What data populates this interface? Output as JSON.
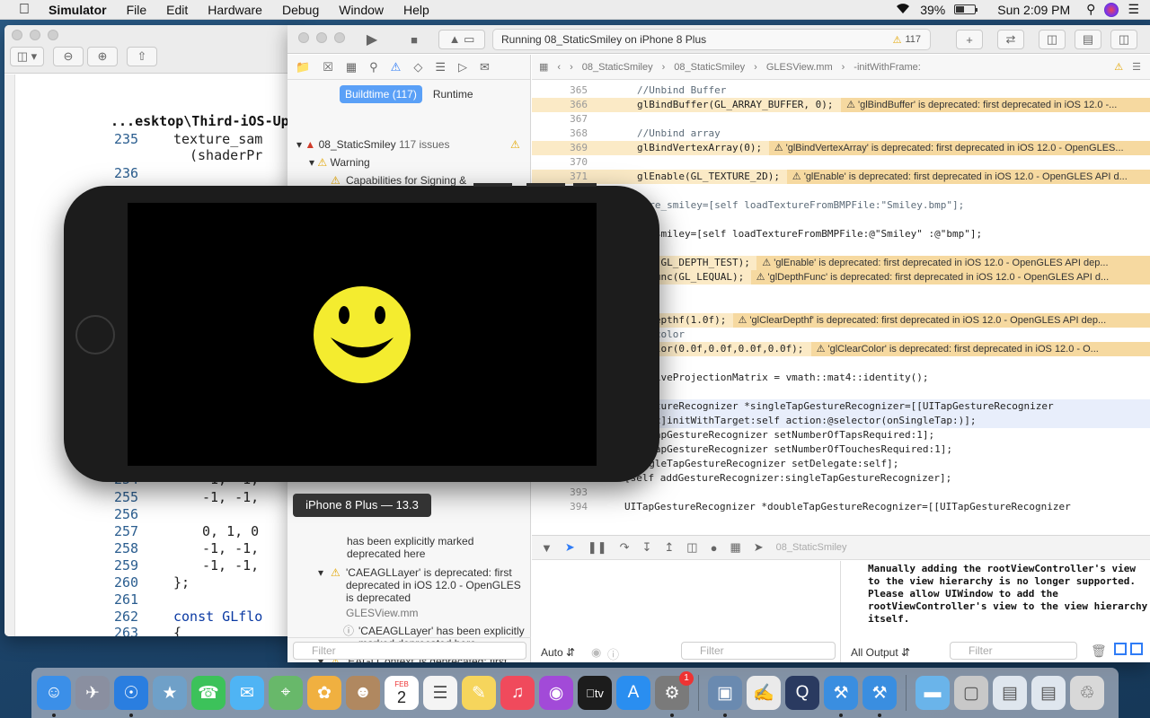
{
  "menubar": {
    "app": "Simulator",
    "items": [
      "File",
      "Edit",
      "Hardware",
      "Debug",
      "Window",
      "Help"
    ],
    "battery": "39%",
    "clock": "Sun 2:09 PM"
  },
  "left_window": {
    "path": "...esktop\\Third-iOS-Uplo",
    "lines": [
      {
        "n": "235",
        "text": "texture_sam"
      },
      {
        "n": "",
        "text": "(shaderPr"
      },
      {
        "n": "236",
        "text": ""
      },
      {
        "n": "254",
        "text": "-1, -1,"
      },
      {
        "n": "255",
        "text": "-1, -1,"
      },
      {
        "n": "256",
        "text": ""
      },
      {
        "n": "257",
        "text": "0, 1, 0"
      },
      {
        "n": "258",
        "text": "-1, -1,"
      },
      {
        "n": "259",
        "text": "-1, -1,"
      },
      {
        "n": "260",
        "text": "};"
      },
      {
        "n": "261",
        "text": ""
      },
      {
        "n": "262",
        "text": "const GLflo"
      },
      {
        "n": "263",
        "text": "{"
      }
    ]
  },
  "xcode": {
    "activity": "Running 08_StaticSmiley on iPhone 8 Plus",
    "warning_count": "117",
    "navigator": {
      "tab_buildtime": "Buildtime (117)",
      "tab_runtime": "Runtime",
      "project": "08_StaticSmiley",
      "project_issues": "117 issues",
      "group_warning": "Warning",
      "issue1": "Capabilities for Signing & Capabilities may not function correctly because its entitlements...",
      "issue2_sub": "has been explicitly marked deprecated here",
      "issue3": "'CAEAGLLayer' is deprecated: first deprecated in iOS 12.0 - OpenGLES is deprecated",
      "issue3_file": "GLESView.mm",
      "issue4": "'CAEAGLLayer' has been explicitly marked deprecated here",
      "issue5": "'EAGLContext' is deprecated: first",
      "filter": "Filter"
    },
    "jumpbar": [
      "08_StaticSmiley",
      "08_StaticSmiley",
      "GLESView.mm",
      "-initWithFrame:"
    ],
    "code": [
      {
        "n": "365",
        "t": "//Unbind Buffer",
        "c": "cmt"
      },
      {
        "n": "366",
        "t": "glBindBuffer(GL_ARRAY_BUFFER, 0);",
        "w": "'glBindBuffer' is deprecated: first deprecated in iOS 12.0 -..."
      },
      {
        "n": "367",
        "t": ""
      },
      {
        "n": "368",
        "t": "//Unbind array",
        "c": "cmt"
      },
      {
        "n": "369",
        "t": "glBindVertexArray(0);",
        "w": "'glBindVertexArray' is deprecated: first deprecated in iOS 12.0 - OpenGLES..."
      },
      {
        "n": "370",
        "t": ""
      },
      {
        "n": "371",
        "t": "glEnable(GL_TEXTURE_2D);",
        "w": "'glEnable' is deprecated: first deprecated in iOS 12.0 - OpenGLES API d..."
      },
      {
        "n": "",
        "t": ""
      },
      {
        "n": "",
        "t": "ture_smiley=[self loadTextureFromBMPFile:\"Smiley.bmp\"];",
        "c": "cmt"
      },
      {
        "n": "",
        "t": ""
      },
      {
        "n": "",
        "t": "re_smiley=[self loadTextureFromBMPFile:@\"Smiley\" :@\"bmp\"];"
      },
      {
        "n": "",
        "t": ""
      },
      {
        "n": "",
        "t": "ble(GL_DEPTH_TEST);",
        "w": "'glEnable' is deprecated: first deprecated in iOS 12.0 - OpenGLES API dep..."
      },
      {
        "n": "",
        "t": "thFunc(GL_LEQUAL);",
        "w": "'glDepthFunc' is deprecated: first deprecated in iOS 12.0 - OpenGLES API d..."
      },
      {
        "n": "",
        "t": ""
      },
      {
        "n": "",
        "t": ""
      },
      {
        "n": "",
        "t": "arDepthf(1.0f);",
        "w": "'glClearDepthf' is deprecated: first deprecated in iOS 12.0 - OpenGLES API dep..."
      },
      {
        "n": "",
        "t": "bg color",
        "c": "cmt"
      },
      {
        "n": "",
        "t": "rColor(0.0f,0.0f,0.0f,0.0f);",
        "w": "'glClearColor' is deprecated: first deprecated in iOS 12.0 - O..."
      },
      {
        "n": "",
        "t": ""
      },
      {
        "n": "",
        "t": "ectiveProjectionMatrix = vmath::mat4::identity();"
      },
      {
        "n": "",
        "t": ""
      },
      {
        "n": "",
        "t": "GestureRecognizer *singleTapGestureRecognizer=[[UITapGestureRecognizer",
        "h": true
      },
      {
        "n": "",
        "t": "lloc]initWithTarget:self action:@selector(onSingleTap:)];",
        "h": true
      },
      {
        "n": "",
        "t": "leTapGestureRecognizer setNumberOfTapsRequired:1];"
      },
      {
        "n": "",
        "t": "leTapGestureRecognizer setNumberOfTouchesRequired:1];"
      },
      {
        "n": "",
        "t": "ingleTapGestureRecognizer setDelegate:self];"
      },
      {
        "n": "392",
        "t": "[self addGestureRecognizer:singleTapGestureRecognizer];",
        "ind": true
      },
      {
        "n": "393",
        "t": ""
      },
      {
        "n": "394",
        "t": "UITapGestureRecognizer *doubleTapGestureRecognizer=[[UITapGestureRecognizer",
        "ind": true
      }
    ],
    "debug_target": "08_StaticSmiley",
    "auto_label": "Auto",
    "all_output": "All Output",
    "console_text": "Manually adding the rootViewController's view to the view hierarchy is no longer supported. Please allow UIWindow to add the rootViewController's view to the view hierarchy itself."
  },
  "simulator": {
    "tooltip": "iPhone 8 Plus — 13.3"
  },
  "dock": {
    "apps": [
      {
        "icon": "finder-icon",
        "color": "#3b8fe8"
      },
      {
        "icon": "launchpad-icon",
        "color": "#8a8fa0"
      },
      {
        "icon": "safari-icon",
        "color": "#2a7ee0"
      },
      {
        "icon": "preview-icon",
        "color": "#6fa0c8"
      },
      {
        "icon": "facetime-icon",
        "color": "#3cc25a"
      },
      {
        "icon": "messages-icon",
        "color": "#4fb4f4"
      },
      {
        "icon": "maps-icon",
        "color": "#68b86a"
      },
      {
        "icon": "photos-icon",
        "color": "#f0b040"
      },
      {
        "icon": "contacts-icon",
        "color": "#b08860"
      },
      {
        "icon": "calendar-icon",
        "color": "#ffffff"
      },
      {
        "icon": "reminders-icon",
        "color": "#f4f4f4"
      },
      {
        "icon": "notes-icon",
        "color": "#f6d55c"
      },
      {
        "icon": "music-icon",
        "color": "#f04a5c"
      },
      {
        "icon": "podcasts-icon",
        "color": "#a24ad8"
      },
      {
        "icon": "tv-icon",
        "color": "#1c1c1c"
      },
      {
        "icon": "appstore-icon",
        "color": "#2a8ef0"
      },
      {
        "icon": "systemprefs-icon",
        "color": "#7a7a7a"
      },
      {
        "icon": "sep",
        "color": ""
      },
      {
        "icon": "preview2-icon",
        "color": "#6a8ab0"
      },
      {
        "icon": "textedit-icon",
        "color": "#eaeaea"
      },
      {
        "icon": "quicktime-icon",
        "color": "#2a3a60"
      },
      {
        "icon": "xcode-icon",
        "color": "#3a8ee0"
      },
      {
        "icon": "xcode-beta-icon",
        "color": "#3a8ee0"
      },
      {
        "icon": "sep",
        "color": ""
      },
      {
        "icon": "folder-icon",
        "color": "#6ab4ea"
      },
      {
        "icon": "screenshot-icon",
        "color": "#c8c8c8"
      },
      {
        "icon": "window1-icon",
        "color": "#dfe6ee"
      },
      {
        "icon": "window2-icon",
        "color": "#dfe6ee"
      },
      {
        "icon": "trash-icon",
        "color": "#d8d8d8"
      }
    ],
    "calendar_month": "FEB",
    "calendar_day": "2",
    "tv_label": "tv",
    "badge": "1"
  }
}
